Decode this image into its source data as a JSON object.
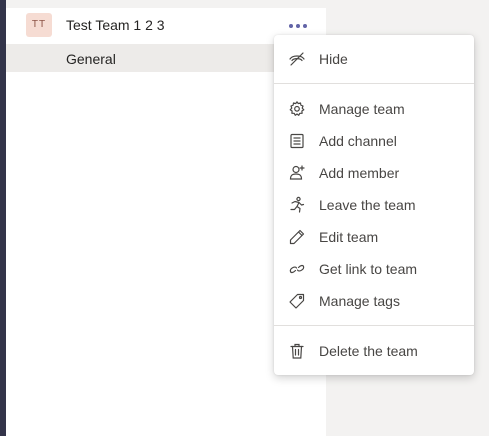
{
  "team": {
    "avatar_initials": "TT",
    "name": "Test Team 1 2 3",
    "more_icon": "more-options-icon"
  },
  "channels": [
    {
      "label": "General"
    }
  ],
  "context_menu": {
    "items": [
      {
        "label": "Hide",
        "icon": "hide-icon"
      },
      {
        "label": "Manage team",
        "icon": "gear-icon"
      },
      {
        "label": "Add channel",
        "icon": "channel-icon"
      },
      {
        "label": "Add member",
        "icon": "add-person-icon"
      },
      {
        "label": "Leave the team",
        "icon": "leave-icon"
      },
      {
        "label": "Edit team",
        "icon": "pencil-icon"
      },
      {
        "label": "Get link to team",
        "icon": "link-icon"
      },
      {
        "label": "Manage tags",
        "icon": "tag-icon"
      },
      {
        "label": "Delete the team",
        "icon": "trash-icon"
      }
    ]
  },
  "colors": {
    "accent": "#6264a7",
    "rail": "#33344a",
    "avatar_bg": "#f6dcd3"
  }
}
